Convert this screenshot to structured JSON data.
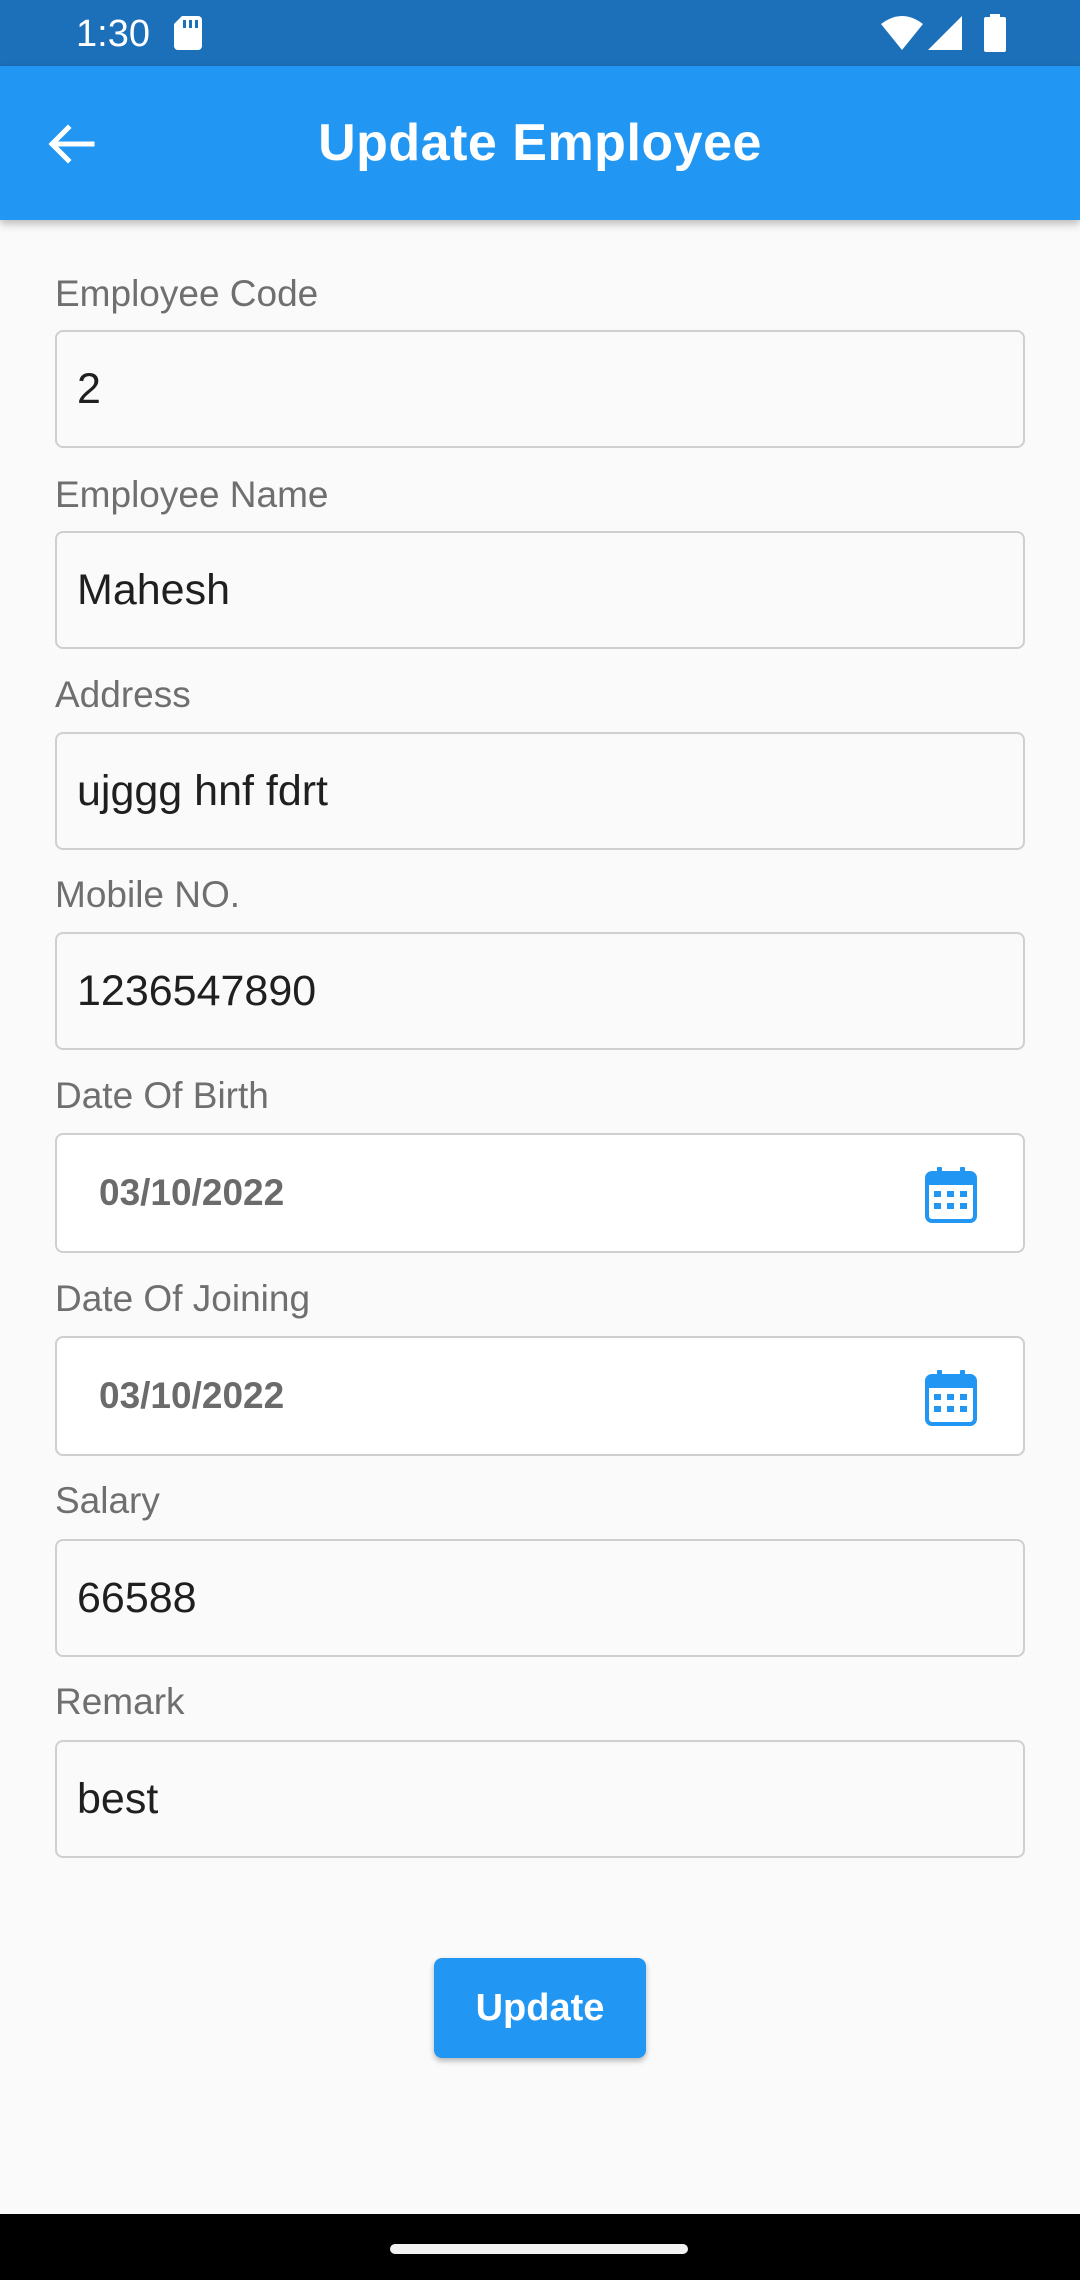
{
  "status_bar": {
    "time": "1:30",
    "icons": [
      "sd-card-icon",
      "wifi-icon",
      "cell-signal-icon",
      "battery-icon"
    ]
  },
  "app_bar": {
    "title": "Update Employee",
    "back_icon": "arrow-back-icon"
  },
  "form": {
    "employee_code": {
      "label": "Employee Code",
      "value": "2"
    },
    "employee_name": {
      "label": "Employee Name",
      "value": "Mahesh"
    },
    "address": {
      "label": "Address",
      "value": "ujggg hnf fdrt"
    },
    "mobile": {
      "label": "Mobile NO.",
      "value": "1236547890"
    },
    "date_of_birth": {
      "label": "Date Of Birth",
      "value": "03/10/2022",
      "icon": "calendar-icon"
    },
    "date_of_joining": {
      "label": "Date Of Joining",
      "value": "03/10/2022",
      "icon": "calendar-icon"
    },
    "salary": {
      "label": "Salary",
      "value": "66588"
    },
    "remark": {
      "label": "Remark",
      "value": "best"
    }
  },
  "actions": {
    "update_label": "Update"
  },
  "colors": {
    "status_bar": "#1C6FB9",
    "app_bar": "#2196F3",
    "accent": "#2196F3",
    "background": "#FAFAFA"
  }
}
